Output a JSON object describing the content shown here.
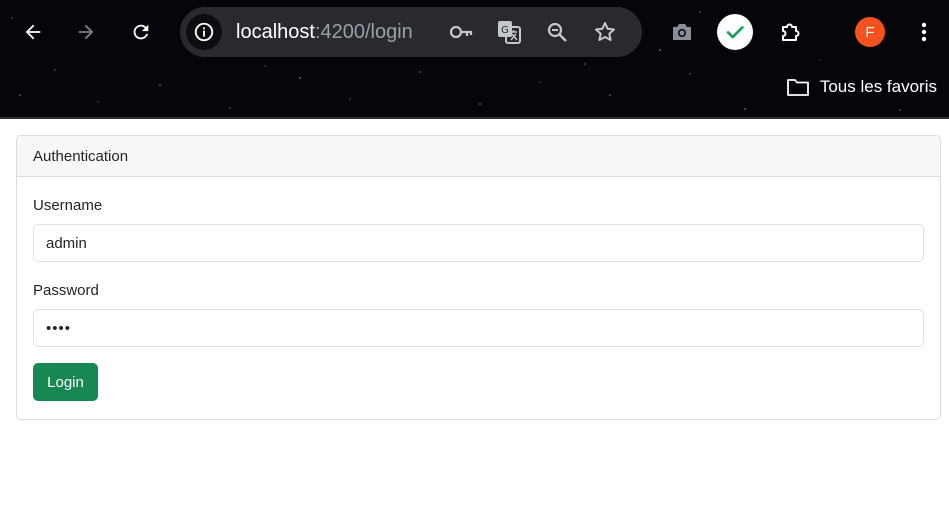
{
  "browser": {
    "url_host": "localhost",
    "url_path": ":4200/login",
    "bookmarks_label": "Tous les favoris",
    "profile_initial": "F",
    "icons": [
      "back-icon",
      "forward-icon",
      "reload-icon",
      "site-info-icon",
      "password-key-icon",
      "translate-icon",
      "zoom-icon",
      "bookmark-star-icon",
      "camera-icon",
      "check-extension-icon",
      "extensions-icon",
      "profile-avatar",
      "menu-icon",
      "folder-icon"
    ],
    "colors": {
      "avatar": "#f4511e",
      "omnibox": "#282a30"
    }
  },
  "card": {
    "header": "Authentication",
    "username_label": "Username",
    "username_value": "admin",
    "password_label": "Password",
    "password_value": "••••",
    "login_label": "Login"
  },
  "colors": {
    "login_button": "#198754"
  }
}
